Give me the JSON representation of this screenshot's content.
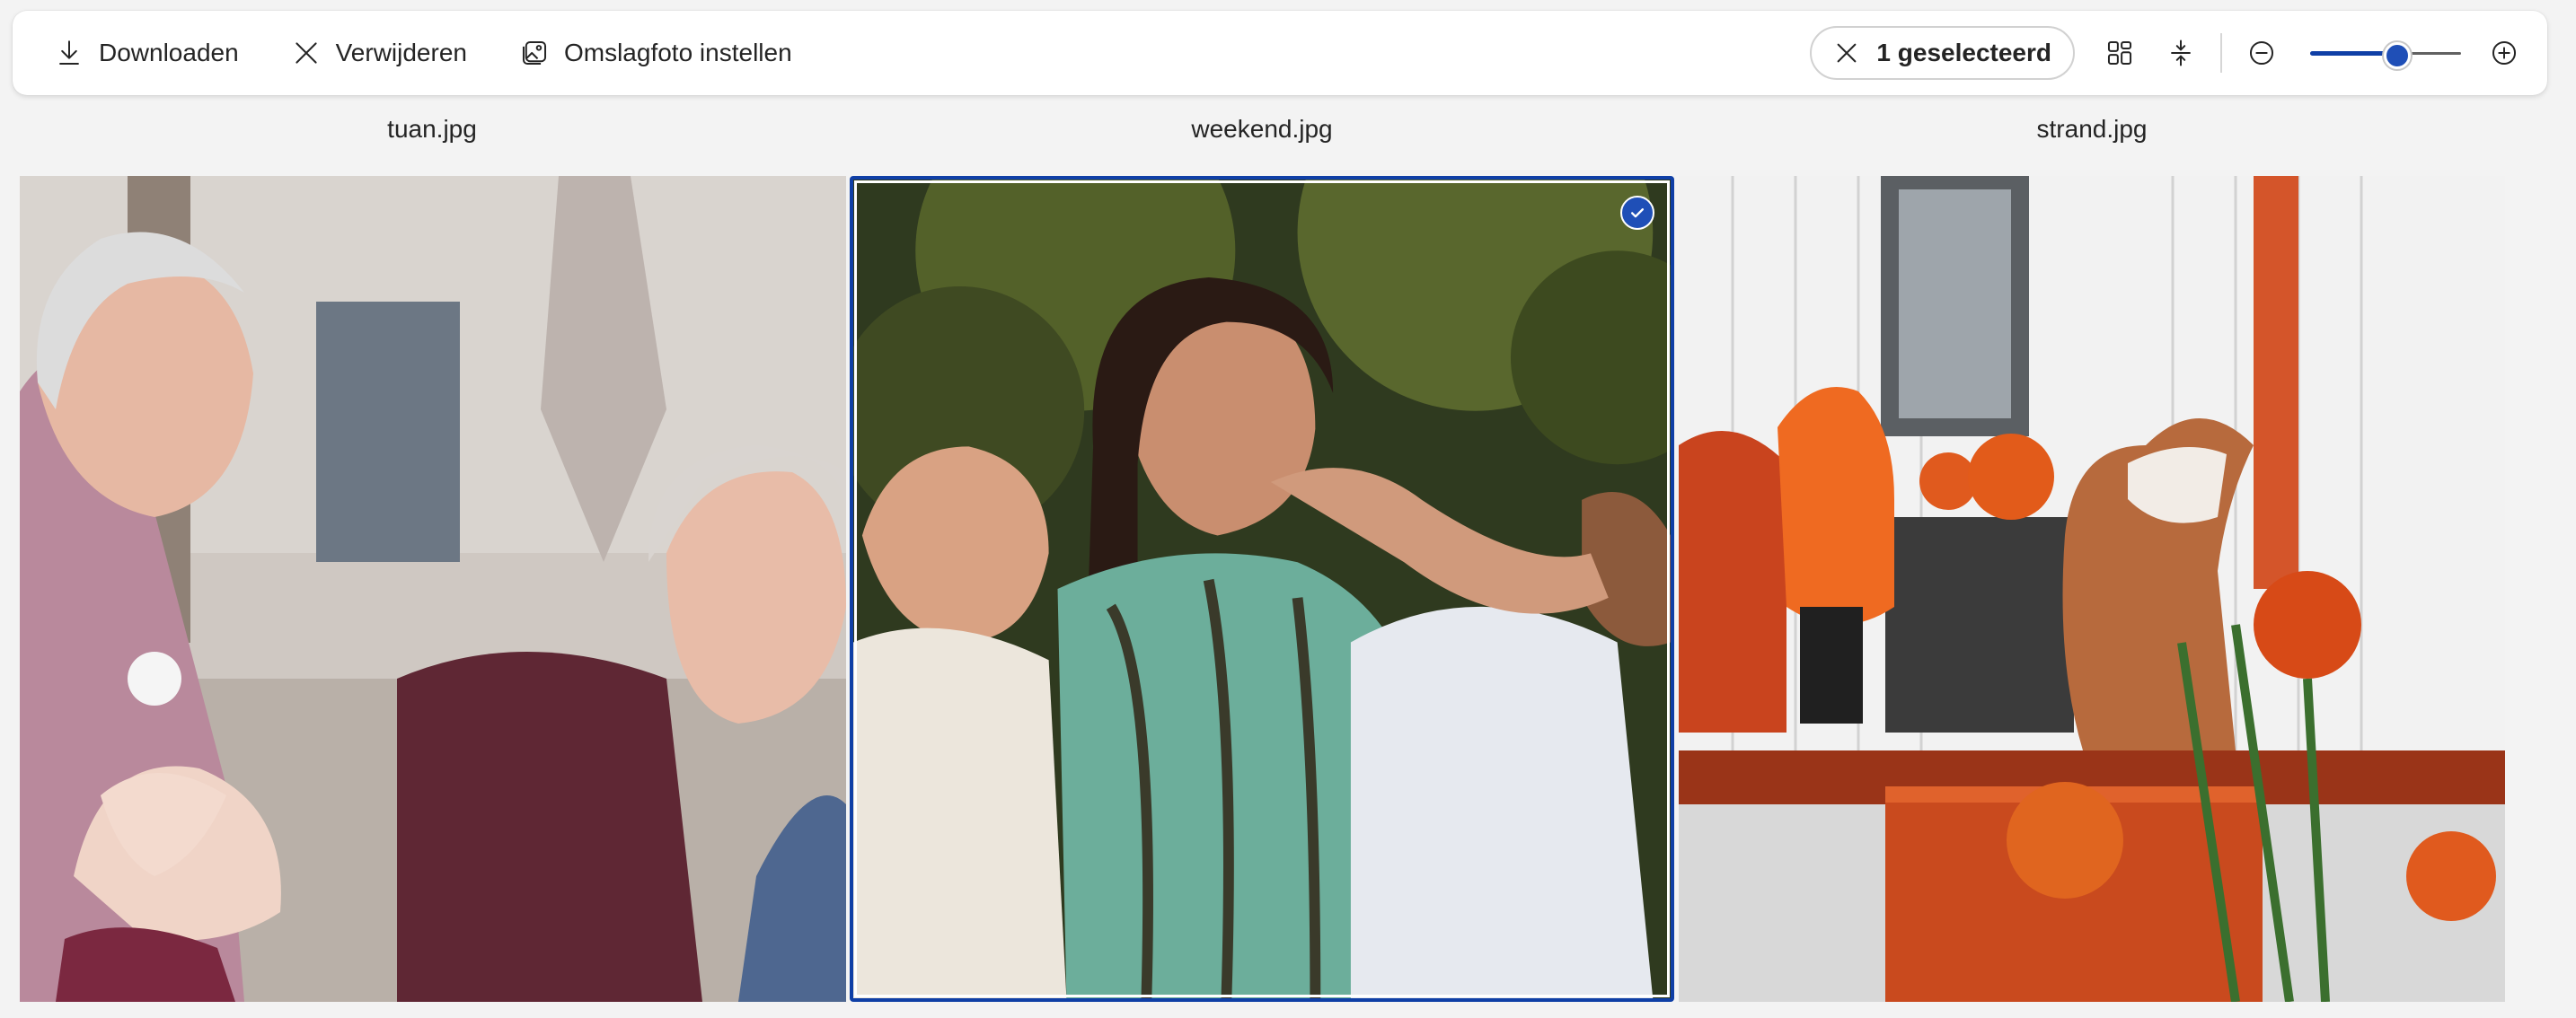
{
  "toolbar": {
    "download_label": "Downloaden",
    "delete_label": "Verwijderen",
    "cover_label": "Omslagfoto instellen",
    "selection_label": "1 geselecteerd",
    "zoom_level": 0.58
  },
  "photos": [
    {
      "name": "tuan.jpg",
      "selected": false
    },
    {
      "name": "weekend.jpg",
      "selected": true
    },
    {
      "name": "strand.jpg",
      "selected": false
    }
  ],
  "colors": {
    "accent": "#0f3fa6",
    "toolbar_bg": "#ffffff",
    "page_bg": "#f3f3f3"
  }
}
